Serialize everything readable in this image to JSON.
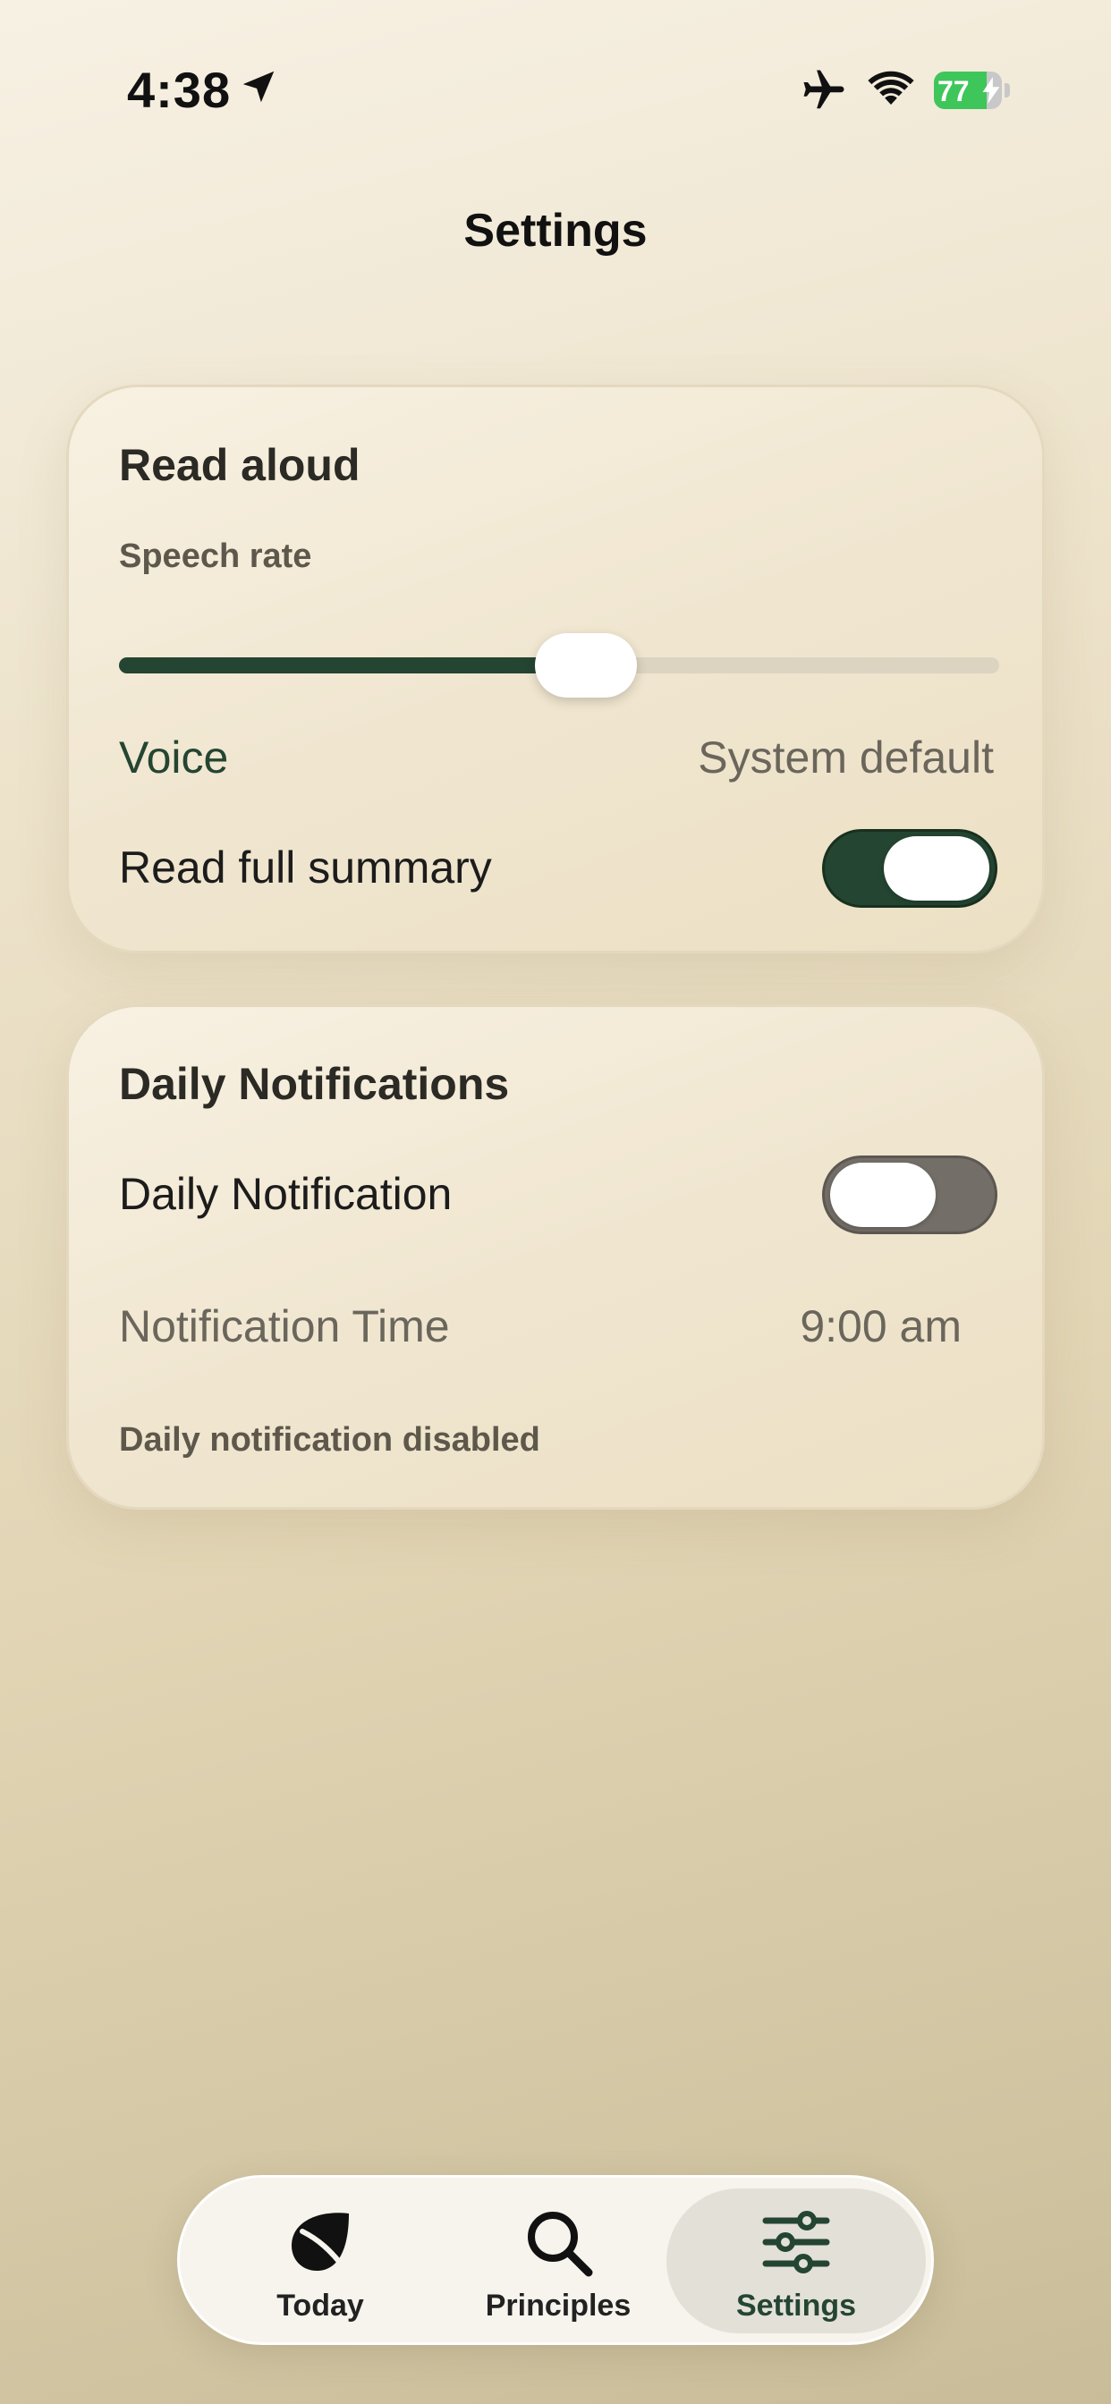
{
  "status_bar": {
    "time": "4:38",
    "battery_level": 77,
    "battery_text": "77",
    "icons": [
      "location-arrow-icon",
      "airplane-icon",
      "wifi-icon",
      "battery-icon"
    ],
    "battery_color": "#3fc65a"
  },
  "header": {
    "title": "Settings"
  },
  "read_aloud": {
    "title": "Read aloud",
    "speech_rate_label": "Speech rate",
    "speech_rate_fraction": 0.53,
    "voice_label": "Voice",
    "voice_value": "System default",
    "full_summary_label": "Read full summary",
    "full_summary_on": true
  },
  "notifications": {
    "title": "Daily Notifications",
    "daily_label": "Daily Notification",
    "daily_on": false,
    "time_label": "Notification Time",
    "time_value": "9:00 am",
    "status_text": "Daily notification disabled"
  },
  "tab_bar": {
    "tabs": [
      {
        "label": "Today",
        "icon": "leaf-icon",
        "active": false
      },
      {
        "label": "Principles",
        "icon": "search-icon",
        "active": false
      },
      {
        "label": "Settings",
        "icon": "sliders-icon",
        "active": true
      }
    ]
  },
  "colors": {
    "accent": "#244532",
    "toggle_off": "#746e68",
    "secondary_text": "#6b665c"
  }
}
